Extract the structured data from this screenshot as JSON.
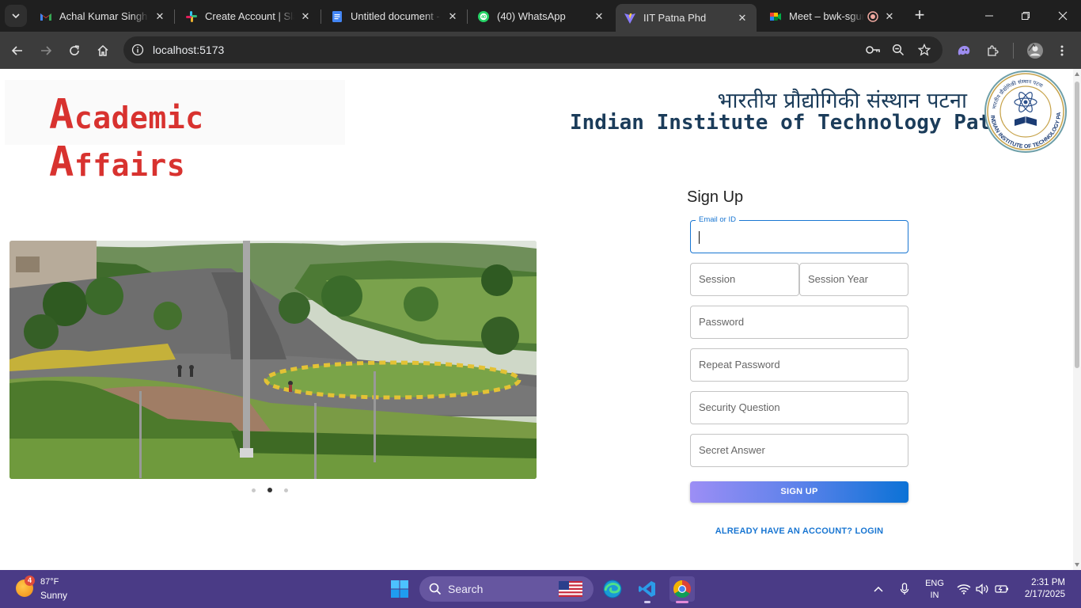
{
  "browser": {
    "tabs": [
      {
        "title": "Achal Kumar Singh has invited you to work with them in Slack",
        "icon": "gmail-icon",
        "close": "✕"
      },
      {
        "title": "Create Account | Slack",
        "icon": "slack-icon",
        "close": "✕"
      },
      {
        "title": "Untitled document - Google Docs",
        "icon": "docs-icon",
        "close": "✕"
      },
      {
        "title": "(40) WhatsApp",
        "icon": "whatsapp-icon",
        "badge": "40",
        "close": "✕"
      },
      {
        "title": "IIT Patna Phd",
        "icon": "vite-icon",
        "close": "✕"
      },
      {
        "title": "Meet – bwk-sgur",
        "icon": "meet-icon",
        "close": "✕"
      }
    ],
    "url": "localhost:5173"
  },
  "header": {
    "brand_first_initial": "A",
    "brand_first_rest": "cademic ",
    "brand_second_initial": "A",
    "brand_second_rest": "ffairs",
    "institute_hindi": "भारतीय प्रौद्योगिकी संस्थान पटना",
    "institute_english": "Indian Institute of Technology Patna",
    "logo_outer_text": "INDIAN INSTITUTE OF TECHNOLOGY PATNA",
    "logo_inner_text": "भारतीय प्रौद्योगिकी संस्थान पटना"
  },
  "carousel": {
    "slide_description": "IIT Patna campus road photograph",
    "dots": 3,
    "active_index": 1
  },
  "signup": {
    "title": "Sign Up",
    "email": {
      "label": "Email or ID",
      "value": ""
    },
    "session": {
      "placeholder": "Session"
    },
    "session_year": {
      "placeholder": "Session Year"
    },
    "password": {
      "placeholder": "Password"
    },
    "repeat_password": {
      "placeholder": "Repeat Password"
    },
    "security_question": {
      "placeholder": "Security Question"
    },
    "secret_answer": {
      "placeholder": "Secret Answer"
    },
    "submit_label": "SIGN UP",
    "login_link": "ALREADY HAVE AN ACCOUNT? LOGIN"
  },
  "taskbar": {
    "weather_badge": "4",
    "weather_temp": "87°F",
    "weather_desc": "Sunny",
    "search_label": "Search",
    "lang_top": "ENG",
    "lang_bottom": "IN",
    "time": "2:31 PM",
    "date": "2/17/2025"
  },
  "colors": {
    "brand_red": "#d8322f",
    "institute_navy": "#1b3c5a",
    "accent_blue": "#1976d2",
    "taskbar": "#4a3b86"
  }
}
